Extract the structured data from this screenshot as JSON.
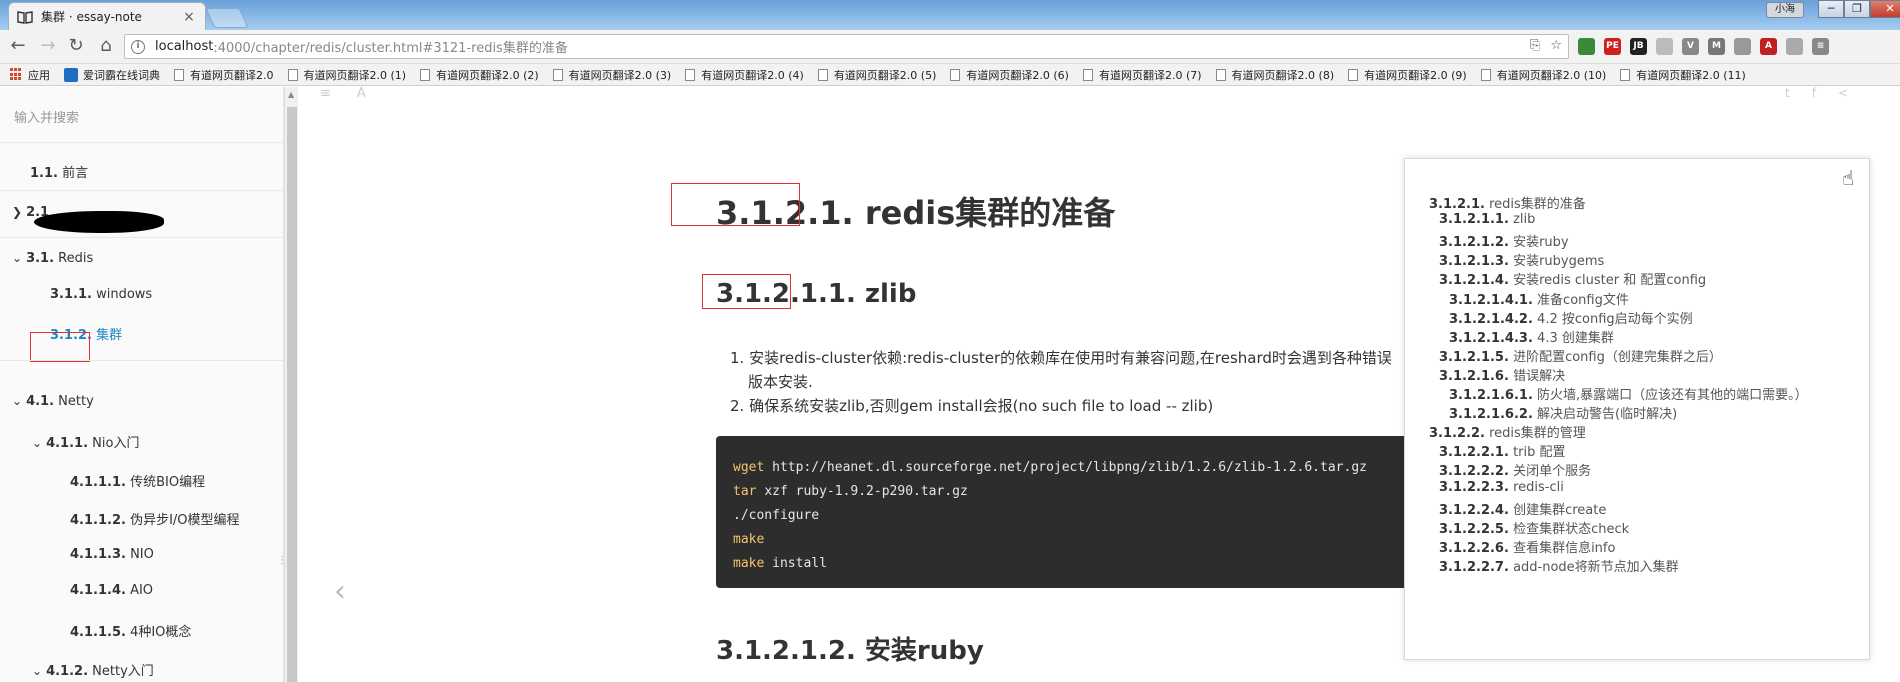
{
  "browser": {
    "tab_title": "集群 · essay-note",
    "tab_close": "×",
    "window_user": "小海",
    "window_buttons": [
      "─",
      "❐",
      "✕"
    ],
    "url_host": "localhost",
    "url_rest": ":4000/chapter/redis/cluster.html#3121-redis集群的准备",
    "bookmarks": [
      "应用",
      "爱词霸在线词典",
      "有道网页翻译2.0",
      "有道网页翻译2.0 (1)",
      "有道网页翻译2.0 (2)",
      "有道网页翻译2.0 (3)",
      "有道网页翻译2.0 (4)",
      "有道网页翻译2.0 (5)",
      "有道网页翻译2.0 (6)",
      "有道网页翻译2.0 (7)",
      "有道网页翻译2.0 (8)",
      "有道网页翻译2.0 (9)",
      "有道网页翻译2.0 (10)",
      "有道网页翻译2.0 (11)"
    ],
    "ext_icons": [
      {
        "name": "chrome-ext-icon",
        "color": "#3b8a3b",
        "label": ""
      },
      {
        "name": "pe-ext-icon",
        "color": "#d02020",
        "label": "PE"
      },
      {
        "name": "jb-ext-icon",
        "color": "#222222",
        "label": "JB"
      },
      {
        "name": "shield-ext-icon",
        "color": "#bbbbbb",
        "label": ""
      },
      {
        "name": "v-ext-icon",
        "color": "#888888",
        "label": "V"
      },
      {
        "name": "mail-ext-icon",
        "color": "#777777",
        "label": "M"
      },
      {
        "name": "clock-ext-icon",
        "color": "#999999",
        "label": ""
      },
      {
        "name": "pdf-ext-icon",
        "color": "#c02020",
        "label": "A"
      },
      {
        "name": "color-ext-icon",
        "color": "#aaaaaa",
        "label": ""
      },
      {
        "name": "menu-ext-icon",
        "color": "#888888",
        "label": "≡"
      }
    ]
  },
  "sidebar": {
    "search_placeholder": "输入并搜索",
    "items": [
      {
        "num": "1.1.",
        "label": "前言"
      },
      {
        "num": "2.1",
        "label": ""
      },
      {
        "num": "3.1.",
        "label": "Redis"
      },
      {
        "num": "3.1.1.",
        "label": "windows"
      },
      {
        "num": "3.1.2.",
        "label": "集群"
      },
      {
        "num": "4.1.",
        "label": "Netty"
      },
      {
        "num": "4.1.1.",
        "label": "Nio入门"
      },
      {
        "num": "4.1.1.1.",
        "label": "传统BIO编程"
      },
      {
        "num": "4.1.1.2.",
        "label": "伪异步I/O模型编程"
      },
      {
        "num": "4.1.1.3.",
        "label": "NIO"
      },
      {
        "num": "4.1.1.4.",
        "label": "AIO"
      },
      {
        "num": "4.1.1.5.",
        "label": "4种IO概念"
      },
      {
        "num": "4.1.2.",
        "label": "Netty入门"
      }
    ]
  },
  "content": {
    "h1": "3.1.2.1. redis集群的准备",
    "h2_zlib": "3.1.2.1.1. zlib",
    "list": [
      "安装redis-cluster依赖:redis-cluster的依赖库在使用时有兼容问题,在reshard时会遇到各种错误",
      "版本安装.",
      "确保系统安装zlib,否则gem install会报(no such file to load -- zlib)"
    ],
    "list_markers": [
      "1.",
      "2."
    ],
    "code": [
      {
        "cmd": "wget",
        "arg": "http://heanet.dl.sourceforge.net/project/libpng/zlib/1.2.6/zlib-1.2.6.tar.gz"
      },
      {
        "cmd": "tar",
        "arg": "xzf ruby-1.9.2-p290.tar.gz"
      },
      {
        "cmd": "",
        "arg": "./configure"
      },
      {
        "cmd": "make",
        "arg": ""
      },
      {
        "cmd": "make",
        "arg": "install"
      }
    ],
    "h2_ruby": "3.1.2.1.2. 安装ruby"
  },
  "float_toc": [
    {
      "num": "3.1.2.1.",
      "label": "redis集群的准备",
      "level": 0
    },
    {
      "num": "3.1.2.1.1.",
      "label": "zlib",
      "level": 1
    },
    {
      "num": "3.1.2.1.2.",
      "label": "安装ruby",
      "level": 1
    },
    {
      "num": "3.1.2.1.3.",
      "label": "安装rubygems",
      "level": 1
    },
    {
      "num": "3.1.2.1.4.",
      "label": "安装redis cluster 和 配置config",
      "level": 1
    },
    {
      "num": "3.1.2.1.4.1.",
      "label": "准备config文件",
      "level": 2
    },
    {
      "num": "3.1.2.1.4.2.",
      "label": "4.2 按config启动每个实例",
      "level": 2
    },
    {
      "num": "3.1.2.1.4.3.",
      "label": "4.3 创建集群",
      "level": 2
    },
    {
      "num": "3.1.2.1.5.",
      "label": "进阶配置config（创建完集群之后）",
      "level": 1
    },
    {
      "num": "3.1.2.1.6.",
      "label": "错误解决",
      "level": 1
    },
    {
      "num": "3.1.2.1.6.1.",
      "label": "防火墙,暴露端口（应该还有其他的端口需要。）",
      "level": 2
    },
    {
      "num": "3.1.2.1.6.2.",
      "label": "解决启动警告(临时解决)",
      "level": 2
    },
    {
      "num": "3.1.2.2.",
      "label": "redis集群的管理",
      "level": 0
    },
    {
      "num": "3.1.2.2.1.",
      "label": "trib 配置",
      "level": 1
    },
    {
      "num": "3.1.2.2.2.",
      "label": "关闭单个服务",
      "level": 1
    },
    {
      "num": "3.1.2.2.3.",
      "label": "redis-cli",
      "level": 1
    },
    {
      "num": "3.1.2.2.4.",
      "label": "创建集群create",
      "level": 1
    },
    {
      "num": "3.1.2.2.5.",
      "label": "检查集群状态check",
      "level": 1
    },
    {
      "num": "3.1.2.2.6.",
      "label": "查看集群信息info",
      "level": 1
    },
    {
      "num": "3.1.2.2.7.",
      "label": "add-node将新节点加入集群",
      "level": 1
    }
  ],
  "colors": {
    "accent": "#1e88c4",
    "annotation": "#e03030",
    "code_bg": "#2d2d2d",
    "code_keyword": "#f5c56c"
  }
}
